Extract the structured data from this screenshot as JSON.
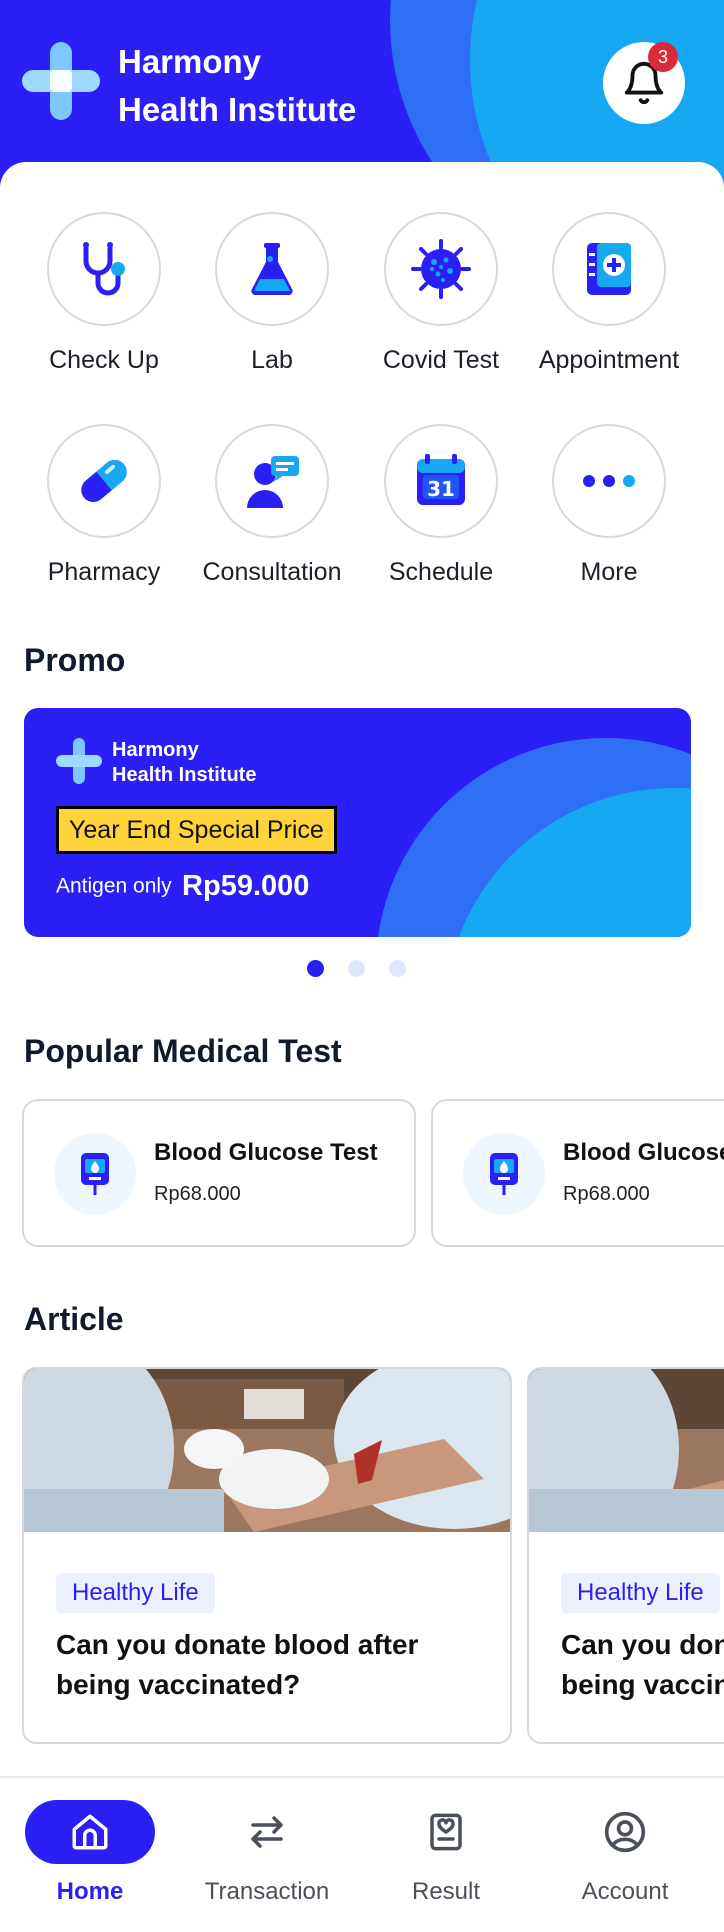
{
  "header": {
    "brand_line1": "Harmony",
    "brand_line2": "Health Institute",
    "notification_count": "3"
  },
  "services": [
    {
      "label": "Check Up",
      "icon": "stethoscope-icon"
    },
    {
      "label": "Lab",
      "icon": "flask-icon"
    },
    {
      "label": "Covid Test",
      "icon": "virus-icon"
    },
    {
      "label": "Appointment",
      "icon": "medical-book-icon"
    },
    {
      "label": "Pharmacy",
      "icon": "pill-icon"
    },
    {
      "label": "Consultation",
      "icon": "consultation-icon"
    },
    {
      "label": "Schedule",
      "icon": "calendar-icon"
    },
    {
      "label": "More",
      "icon": "more-dots-icon"
    }
  ],
  "promo": {
    "section_title": "Promo",
    "brand_line1": "Harmony",
    "brand_line2": "Health Institute",
    "tag": "Year End Special Price",
    "price_label": "Antigen only",
    "price_value": "Rp59.000",
    "slide_count": 3,
    "active_slide": 1
  },
  "popular": {
    "section_title": "Popular Medical Test",
    "items": [
      {
        "name": "Blood Glucose Test",
        "price": "Rp68.000"
      },
      {
        "name": "Blood Glucose Test",
        "price": "Rp68.000"
      }
    ]
  },
  "articles": {
    "section_title": "Article",
    "items": [
      {
        "category": "Healthy Life",
        "title": "Can you donate blood after being vaccinated?"
      },
      {
        "category": "Healthy Life",
        "title": "Can you donate blood after being vaccinated?"
      }
    ]
  },
  "nav": {
    "items": [
      {
        "label": "Home",
        "icon": "home-icon",
        "active": true
      },
      {
        "label": "Transaction",
        "icon": "transfer-arrows-icon",
        "active": false
      },
      {
        "label": "Result",
        "icon": "result-clipboard-icon",
        "active": false
      },
      {
        "label": "Account",
        "icon": "account-icon",
        "active": false
      }
    ]
  },
  "colors": {
    "primary": "#2a1ff5",
    "accent_blue": "#17a8f3",
    "badge_red": "#d92b3a",
    "promo_tag": "#ffd43b"
  }
}
